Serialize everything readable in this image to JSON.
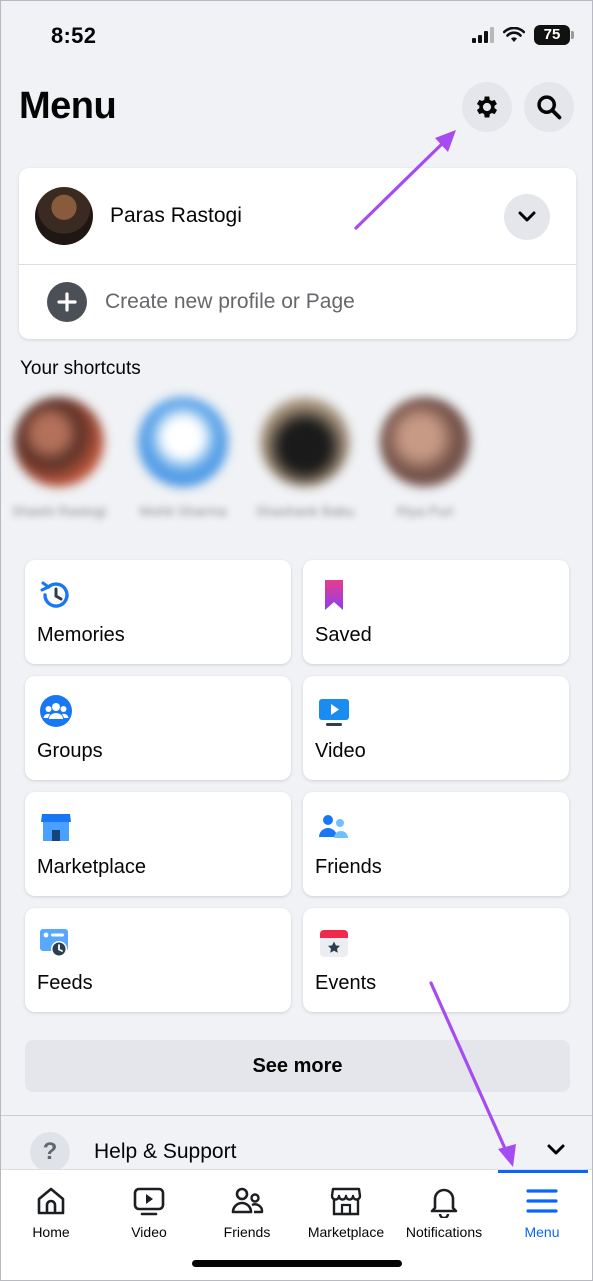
{
  "status_bar": {
    "time": "8:52",
    "battery": "75"
  },
  "header": {
    "title": "Menu",
    "settings_icon": "gear-icon",
    "search_icon": "search-icon"
  },
  "profile": {
    "name": "Paras Rastogi",
    "create_label": "Create new profile or Page"
  },
  "shortcuts": {
    "heading": "Your shortcuts",
    "items": [
      {
        "name": "Shashi Rastogi"
      },
      {
        "name": "Mohit Sharma"
      },
      {
        "name": "Shashank Babu"
      },
      {
        "name": "Riya Puri"
      }
    ]
  },
  "tiles": [
    {
      "label": "Memories",
      "icon": "memories-icon"
    },
    {
      "label": "Saved",
      "icon": "saved-icon"
    },
    {
      "label": "Groups",
      "icon": "groups-icon"
    },
    {
      "label": "Video",
      "icon": "video-icon"
    },
    {
      "label": "Marketplace",
      "icon": "marketplace-icon"
    },
    {
      "label": "Friends",
      "icon": "friends-icon"
    },
    {
      "label": "Feeds",
      "icon": "feeds-icon"
    },
    {
      "label": "Events",
      "icon": "events-icon"
    }
  ],
  "see_more": "See more",
  "help": {
    "label": "Help & Support"
  },
  "tab_bar": {
    "tabs": [
      {
        "label": "Home"
      },
      {
        "label": "Video"
      },
      {
        "label": "Friends"
      },
      {
        "label": "Marketplace"
      },
      {
        "label": "Notifications"
      },
      {
        "label": "Menu"
      }
    ],
    "active": "Menu"
  },
  "colors": {
    "accent": "#0866ff",
    "annotation_arrow": "#a64bf4",
    "background": "#f0f2f5"
  }
}
